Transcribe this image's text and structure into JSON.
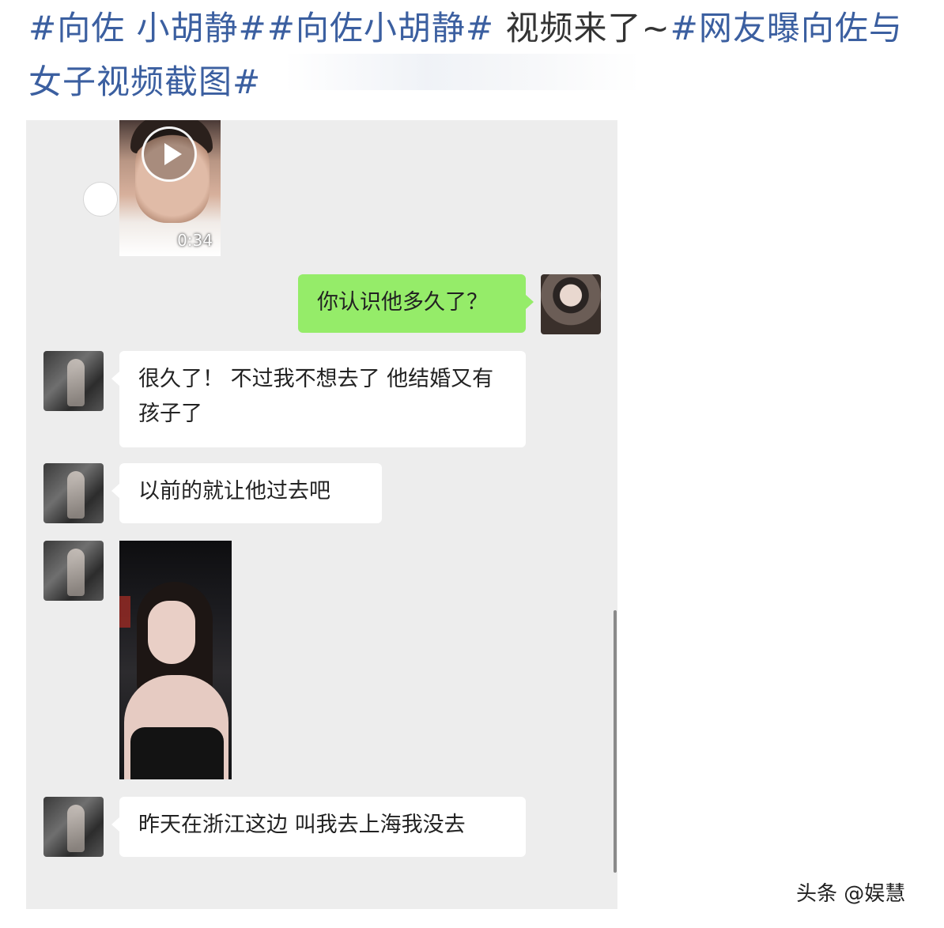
{
  "headline": {
    "line1_tags": "#向佐 小胡静##向佐小胡静#",
    "line1_text": " 视频来了~",
    "line1_tag2": "#网友曝向佐与",
    "line2_tag": "女子视频截图#"
  },
  "chat": {
    "video_message": {
      "duration": "0:34"
    },
    "messages": [
      {
        "side": "right",
        "text": "你认识他多久了？"
      },
      {
        "side": "left",
        "text": "很久了！ 不过我不想去了 他结婚又有孩子了"
      },
      {
        "side": "left",
        "text": "以前的就让他过去吧"
      },
      {
        "side": "left",
        "type": "image"
      },
      {
        "side": "left",
        "text": "昨天在浙江这边 叫我去上海我没去"
      }
    ]
  },
  "watermark": "头条 @娱慧"
}
